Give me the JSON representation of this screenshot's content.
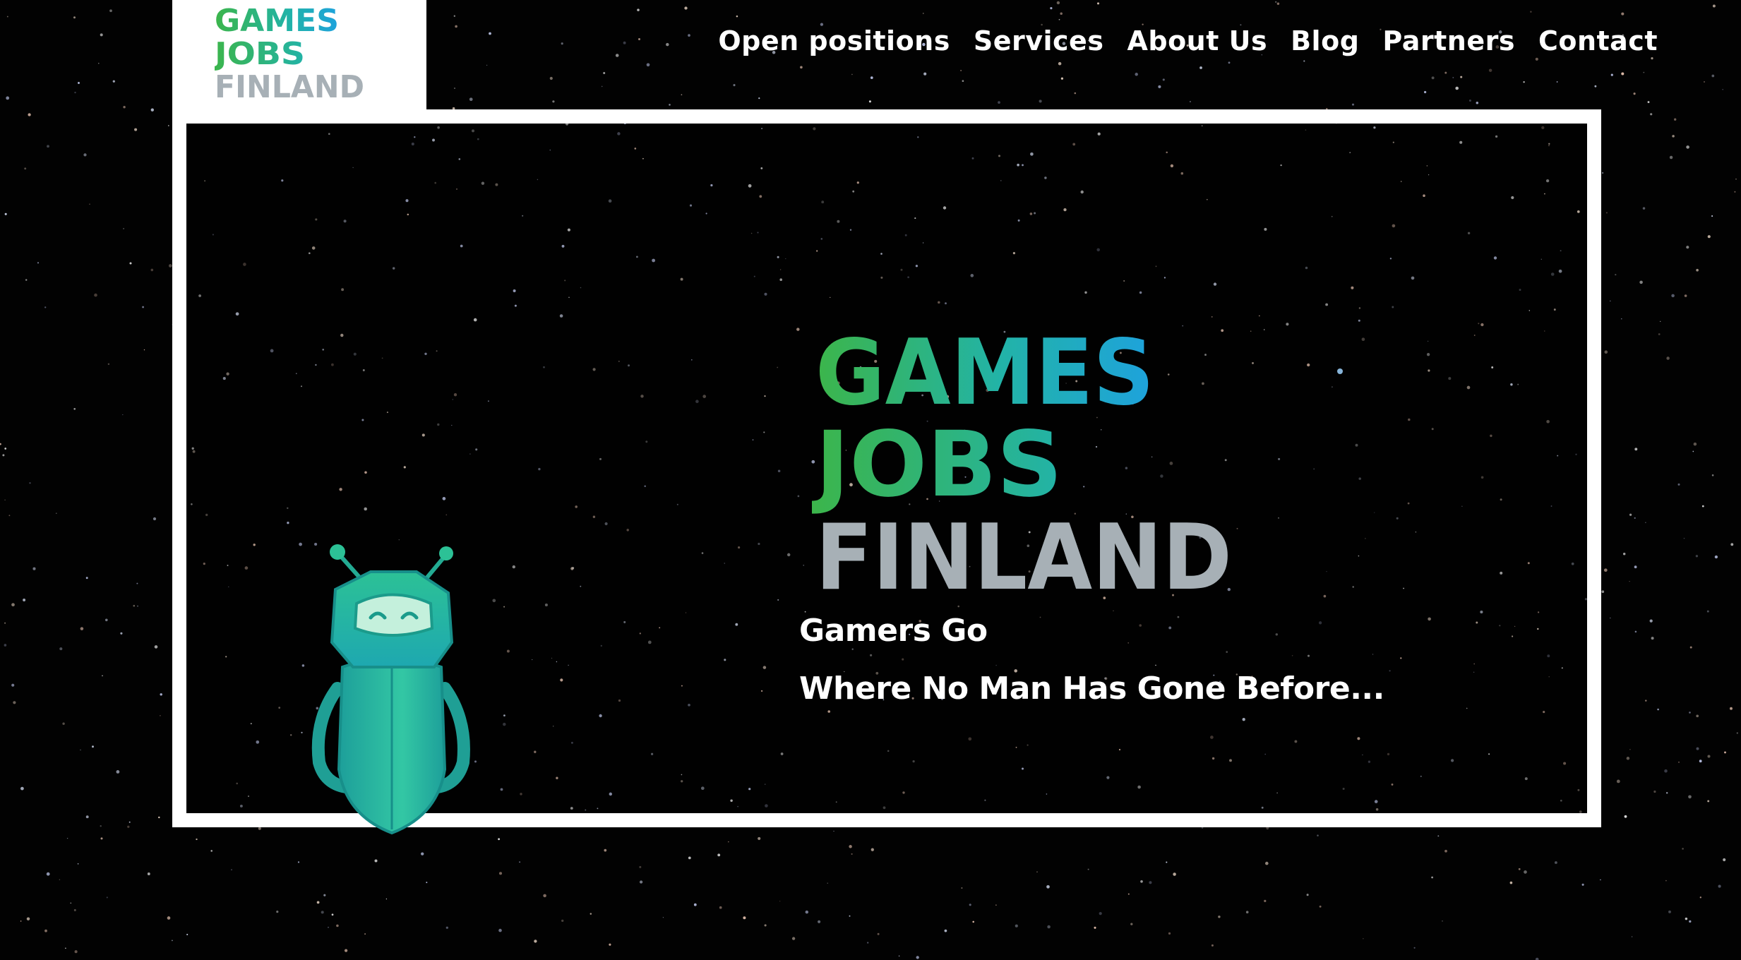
{
  "brand": {
    "logo_lines": [
      "GAMES",
      "JOBS",
      "FINLAND"
    ],
    "colors": {
      "green": "#3cb54a",
      "teal": "#22b3a8",
      "blue": "#1ea2dd",
      "gray": "#a7b0b6"
    }
  },
  "nav": {
    "items": [
      {
        "label": "Open positions"
      },
      {
        "label": "Services"
      },
      {
        "label": "About Us"
      },
      {
        "label": "Blog"
      },
      {
        "label": "Partners"
      },
      {
        "label": "Contact"
      }
    ]
  },
  "hero": {
    "tagline_line1": "Gamers Go",
    "tagline_line2": "Where No Man Has Gone Before..."
  }
}
